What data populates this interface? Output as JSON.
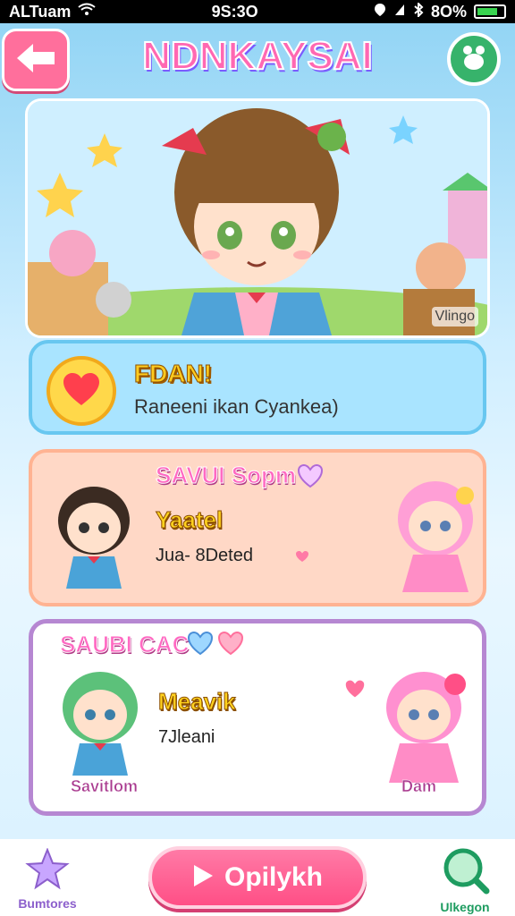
{
  "status_bar": {
    "carrier": "ALTuam",
    "time": "9S:3O",
    "battery": "8O%",
    "battery_level": 0.8
  },
  "header": {
    "title": "NDNKAYSAI",
    "back_icon": "arrow-left-icon",
    "menu_icon": "paw-icon"
  },
  "hero": {
    "caption": "Vlingo"
  },
  "objective": {
    "title": "FDAN!",
    "text": "Raneeni ikan Cyankea)",
    "icon": "heart-icon"
  },
  "character_cards": [
    {
      "title": "SAVUI Sopm",
      "name": "Yaatel",
      "subtext": "Jua- 8Deted",
      "left_label": "",
      "right_label": ""
    },
    {
      "title": "SAUBI CAC",
      "name": "Meavik",
      "subtext": "7Jleani",
      "left_label": "Savitlom",
      "right_label": "Dam"
    }
  ],
  "bottom_bar": {
    "left_label": "Bumtores",
    "play_label": "Opilykh",
    "right_label": "Ulkegon",
    "play_icon": "play-icon"
  },
  "colors": {
    "accent_pink": "#ff4f86",
    "sky": "#8fd3f4",
    "objective_panel": "#a9e4ff",
    "card_peach": "#ffd8c6",
    "card_border_purple": "#b687d2",
    "green": "#37b36b"
  }
}
